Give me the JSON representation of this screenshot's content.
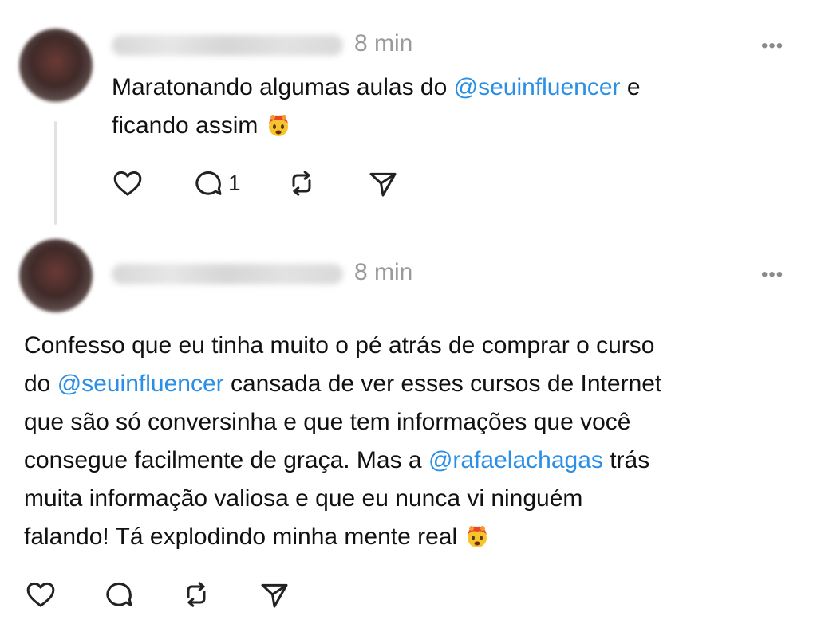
{
  "posts": [
    {
      "username": "",
      "time": "8 min",
      "more": "•••",
      "text_before": "Maratonando algumas aulas do ",
      "mention": "@seuinfluencer",
      "text_mid": " e",
      "text_line2": "ficando assim",
      "emoji": "exploding-head-icon",
      "actions": {
        "reply_count": "1"
      }
    },
    {
      "username": "",
      "time": "8 min",
      "more": "•••",
      "lines": {
        "l1": "Confesso que eu tinha muito o pé atrás de comprar o curso",
        "l2_pre": "do ",
        "l2_mention": "@seuinfluencer",
        "l2_post": " cansada de ver esses cursos de Internet",
        "l3": "que são só conversinha e que tem informações que você",
        "l4_pre": "consegue facilmente de graça. Mas a ",
        "l4_mention": "@rafaelachagas",
        "l4_post": " trás",
        "l5": "muita informação valiosa e que eu nunca vi ninguém",
        "l6": "falando! Tá explodindo minha mente real"
      },
      "emoji": "exploding-head-icon"
    }
  ],
  "colors": {
    "mention": "#2a8fe5",
    "time": "#9a9a9a",
    "icon": "#222222"
  }
}
